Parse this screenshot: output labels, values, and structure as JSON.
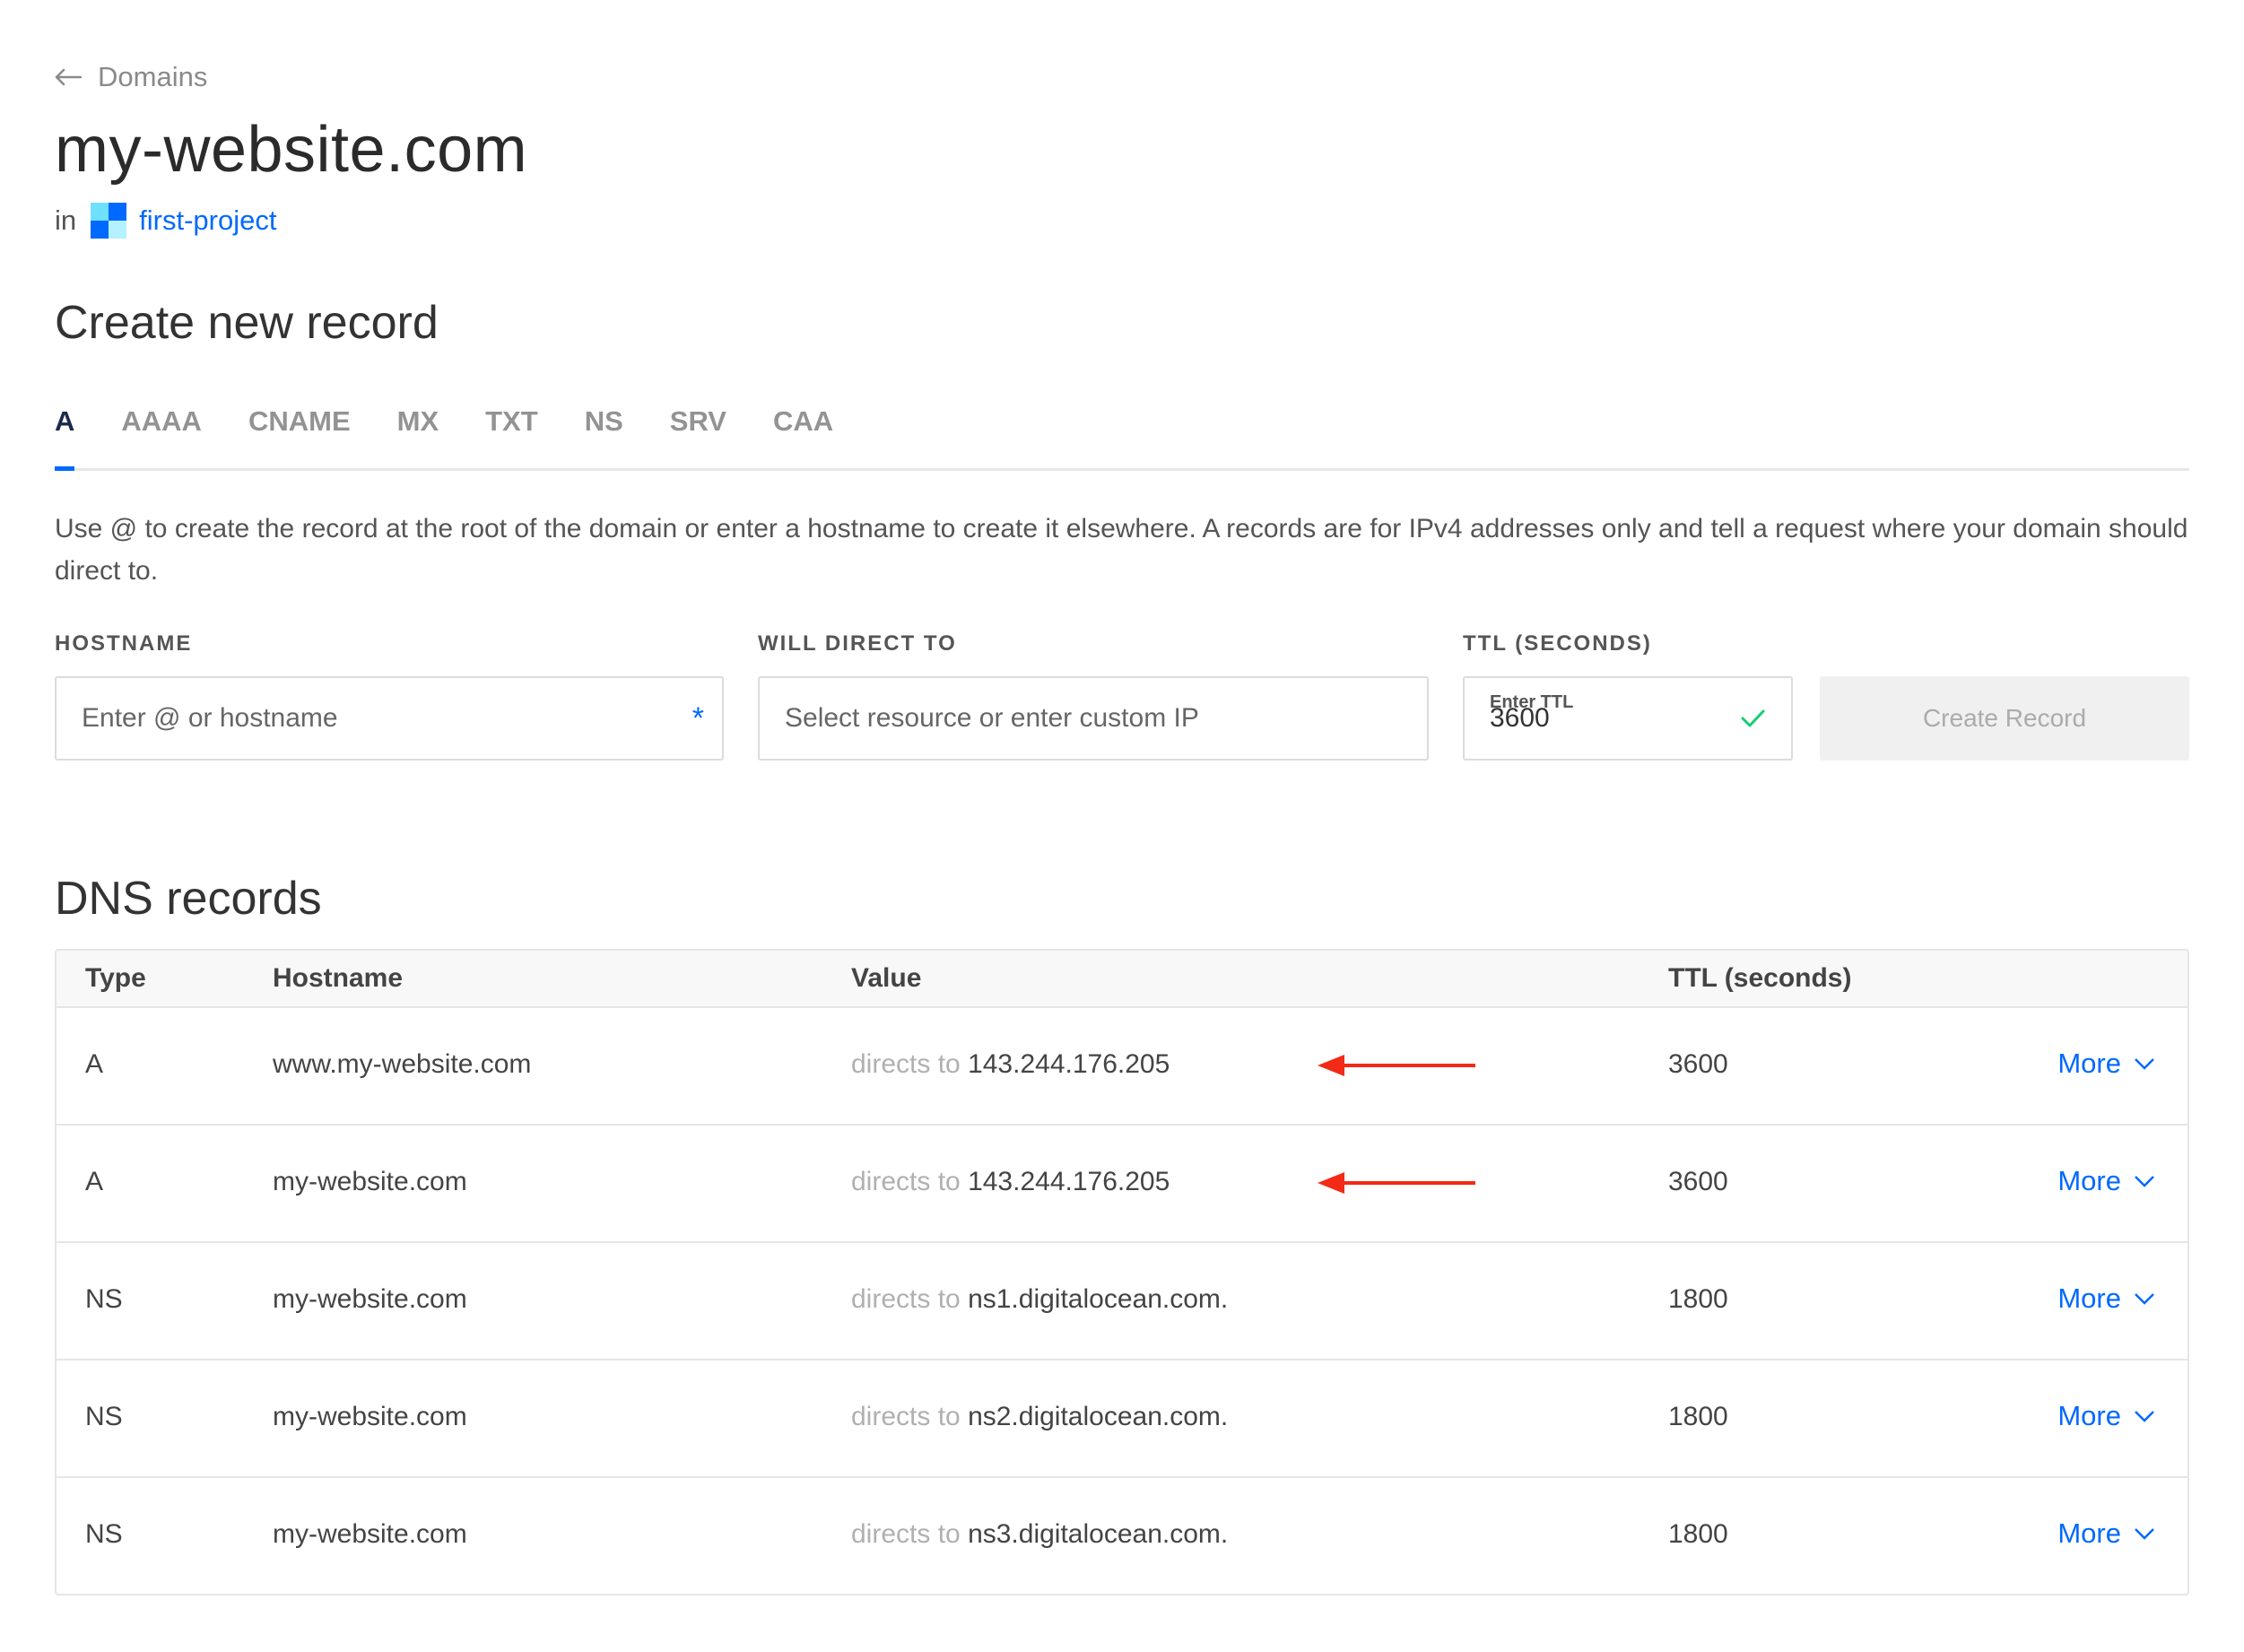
{
  "breadcrumb": {
    "label": "Domains",
    "icon": "arrow-left-icon"
  },
  "title": "my-website.com",
  "project": {
    "prefix": "in",
    "name": "first-project",
    "icon": "project-icon"
  },
  "create": {
    "title": "Create new record",
    "tabs": [
      {
        "label": "A",
        "active": true
      },
      {
        "label": "AAAA",
        "active": false
      },
      {
        "label": "CNAME",
        "active": false
      },
      {
        "label": "MX",
        "active": false
      },
      {
        "label": "TXT",
        "active": false
      },
      {
        "label": "NS",
        "active": false
      },
      {
        "label": "SRV",
        "active": false
      },
      {
        "label": "CAA",
        "active": false
      }
    ],
    "help": "Use @ to create the record at the root of the domain or enter a hostname to create it elsewhere. A records are for IPv4 addresses only and tell a request where your domain should direct to.",
    "hostname": {
      "label": "HOSTNAME",
      "placeholder": "Enter @ or hostname",
      "required_mark": "*"
    },
    "direct": {
      "label": "WILL DIRECT TO",
      "placeholder": "Select resource or enter custom IP"
    },
    "ttl": {
      "label": "TTL (SECONDS)",
      "small_label": "Enter TTL",
      "value": "3600"
    },
    "button": "Create Record"
  },
  "dns": {
    "title": "DNS records",
    "columns": {
      "type": "Type",
      "hostname": "Hostname",
      "value": "Value",
      "ttl": "TTL (seconds)"
    },
    "value_prefix": "directs to",
    "more_label": "More",
    "rows": [
      {
        "type": "A",
        "hostname": "www.my-website.com",
        "value": "143.244.176.205",
        "ttl": "3600"
      },
      {
        "type": "A",
        "hostname": "my-website.com",
        "value": "143.244.176.205",
        "ttl": "3600"
      },
      {
        "type": "NS",
        "hostname": "my-website.com",
        "value": "ns1.digitalocean.com.",
        "ttl": "1800"
      },
      {
        "type": "NS",
        "hostname": "my-website.com",
        "value": "ns2.digitalocean.com.",
        "ttl": "1800"
      },
      {
        "type": "NS",
        "hostname": "my-website.com",
        "value": "ns3.digitalocean.com.",
        "ttl": "1800"
      }
    ]
  },
  "colors": {
    "accent": "#0069ff",
    "annotation_arrow": "#f22a16",
    "success": "#15cd72"
  }
}
